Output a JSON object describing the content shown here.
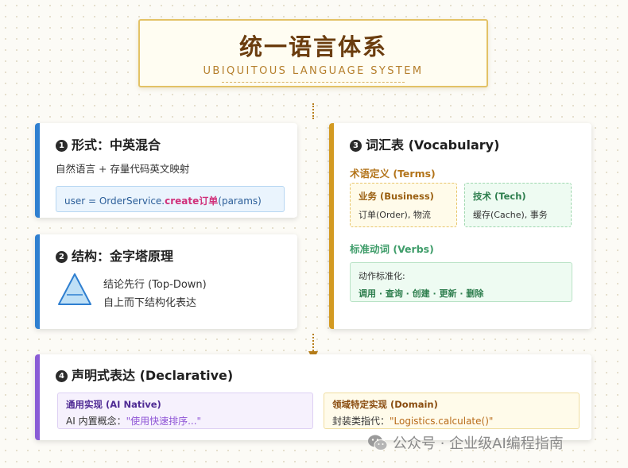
{
  "header": {
    "title": "统一语言体系",
    "subtitle": "UBIQUITOUS LANGUAGE SYSTEM"
  },
  "card1": {
    "number": "1",
    "title": "形式：中英混合",
    "description": "自然语言 + 存量代码英文映射",
    "code_prefix": "user = OrderService.",
    "code_highlight": "create订单",
    "code_suffix": "(params)"
  },
  "card2": {
    "number": "2",
    "title": "结构：金字塔原理",
    "line1": "结论先行 (Top-Down)",
    "line2": "自上而下结构化表达",
    "icon": "pyramid-icon"
  },
  "card3": {
    "number": "3",
    "title": "词汇表 (Vocabulary)",
    "terms_heading": "术语定义 (Terms)",
    "business_title": "业务 (Business)",
    "business_text": "订单(Order), 物流",
    "tech_title": "技术 (Tech)",
    "tech_text": "缓存(Cache), 事务",
    "verbs_heading": "标准动词 (Verbs)",
    "verbs_lead": "动作标准化:",
    "verbs_list": "调用 · 查询 · 创建 · 更新 · 删除"
  },
  "card4": {
    "number": "4",
    "title": "声明式表达 (Declarative)",
    "ai_title": "通用实现 (AI Native)",
    "ai_prefix": "AI 内置概念：",
    "ai_quote": "\"使用快速排序...\"",
    "domain_title": "领域特定实现 (Domain)",
    "domain_prefix": "封装类指代：",
    "domain_quote": "\"Logistics.calculate()\""
  },
  "watermark": {
    "text": "公众号 · 企业级AI编程指南",
    "icon": "wechat-icon"
  },
  "colors": {
    "blue_accent": "#2f7fd0",
    "gold_accent": "#d39a22",
    "purple_accent": "#8a5cd6",
    "title_brown": "#6b3d0f",
    "highlight_pink": "#d0307a"
  }
}
